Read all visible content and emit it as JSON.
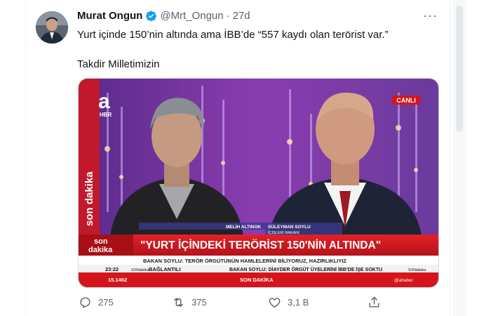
{
  "tweet": {
    "author_name": "Murat Ongun",
    "handle": "@Mrt_Ongun",
    "separator": "·",
    "time": "27d",
    "more": "···",
    "lines": [
      "Yurt içinde 150’nin altında ama İBB’de “557 kaydı olan terörist var.”",
      "Takdir Milletimizin"
    ]
  },
  "media": {
    "channel_logo": "a",
    "channel_sub": "HBR",
    "live_badge": "CANLI",
    "side_text": "son dakika",
    "name_left": "MELİH ALTINOK",
    "name_right": "SÜLEYMAN SOYLU",
    "name_right_title": "İÇİŞLERİ BAKANI",
    "corner_logo_top": "son",
    "corner_logo_bottom": "dakika",
    "headline": "\"YURT İÇİNDEKİ TERÖRİST 150'NİN ALTINDA\"",
    "subhead": "BAKAN SOYLU: TERÖR ÖRGÜTÜNÜN HAMLELERİNİ BİLİYORUZ, HAZIRLIKLIYIZ",
    "clock": "23:22",
    "ticker_left": "BAĞLANTILI",
    "ticker_right": "BAKAN SOYLU: DİAYDER ÖRGÜT ÜYELERİNİ İBB'DE İŞE SOKTU",
    "ticker_brand": "SONdakika",
    "ticker_brand2": "SONdakika",
    "stock": "15.1462",
    "bottom_label": "SON DAKİKA",
    "bottom_handle": "@ahaber"
  },
  "actions": {
    "replies": "275",
    "retweets": "375",
    "likes": "3,1 B"
  },
  "icons": [
    "verified-badge-icon",
    "more-icon",
    "reply-icon",
    "retweet-icon",
    "like-icon",
    "share-icon"
  ],
  "colors": {
    "verified": "#1d9bf0",
    "broadcast_red": "#d4161c",
    "text_secondary": "#536471"
  }
}
